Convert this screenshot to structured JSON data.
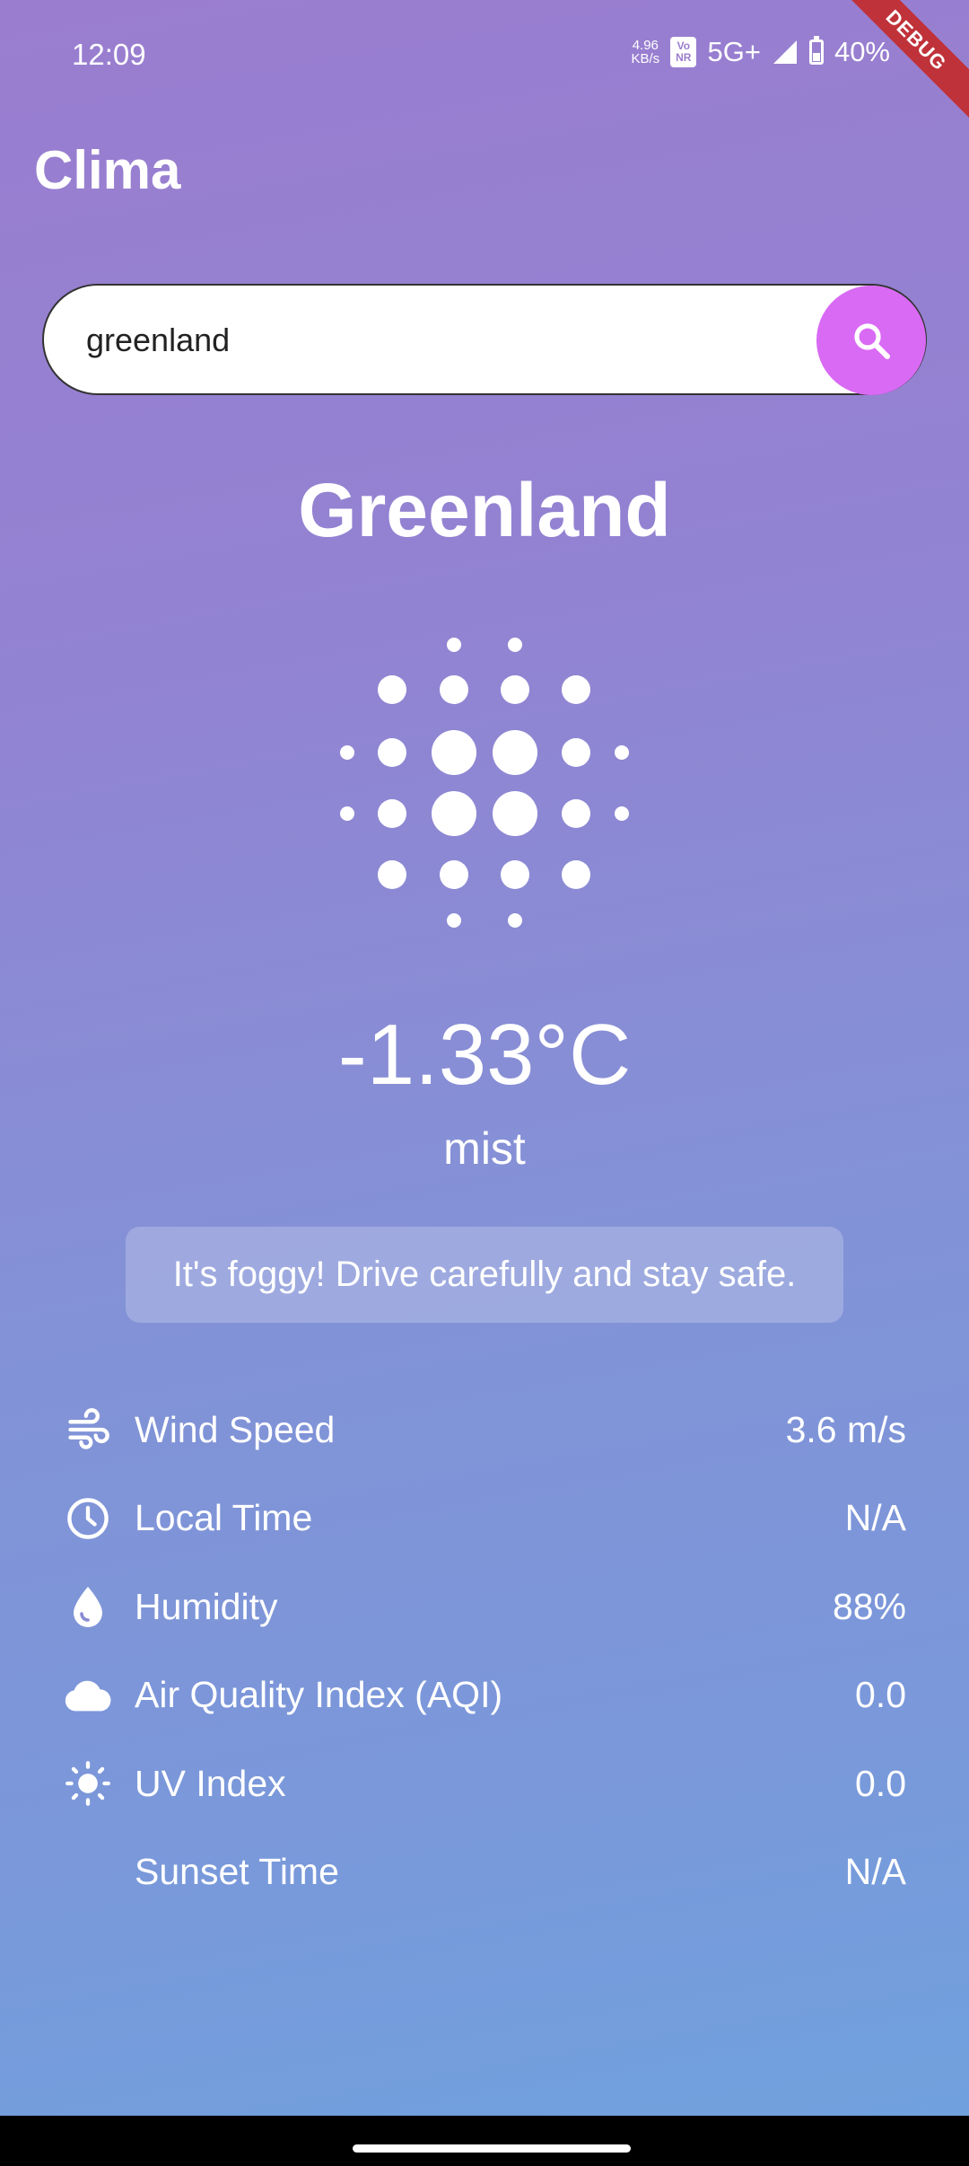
{
  "status_bar": {
    "time": "12:09",
    "net_speed_value": "4.96",
    "net_speed_unit": "KB/s",
    "volte_top": "Vo",
    "volte_bottom": "NR",
    "network": "5G+",
    "battery_percent": "40%",
    "battery_level": 0.4
  },
  "debug_banner": "DEBUG",
  "app": {
    "title": "Clima"
  },
  "search": {
    "value": "greenland",
    "button_icon": "search-icon"
  },
  "weather": {
    "city": "Greenland",
    "icon": "mist-dots-icon",
    "temperature": "-1.33°C",
    "description": "mist",
    "advice": "It's foggy! Drive carefully and stay safe."
  },
  "stats": [
    {
      "icon": "wind-icon",
      "label": "Wind Speed",
      "value": "3.6 m/s"
    },
    {
      "icon": "clock-icon",
      "label": "Local Time",
      "value": "N/A"
    },
    {
      "icon": "water-drop-icon",
      "label": "Humidity",
      "value": "88%"
    },
    {
      "icon": "cloud-icon",
      "label": "Air Quality Index (AQI)",
      "value": "0.0"
    },
    {
      "icon": "sun-icon",
      "label": "UV Index",
      "value": "0.0"
    },
    {
      "icon": "moon-icon",
      "label": "Sunset Time",
      "value": "N/A"
    }
  ],
  "colors": {
    "gradient_top": "#9a7dcf",
    "gradient_bottom": "#6fa2de",
    "search_button": "#d96af4",
    "debug_ribbon": "#c0323a"
  }
}
